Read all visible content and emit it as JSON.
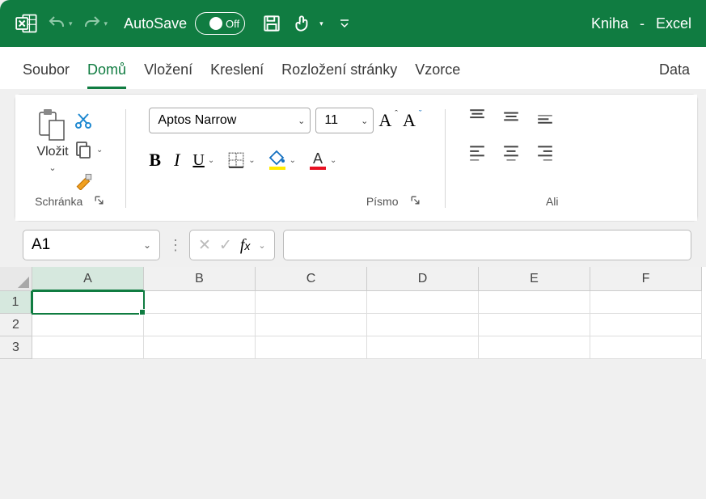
{
  "title": {
    "autosave_label": "AutoSave",
    "autosave_state": "Off",
    "doc_name": "Kniha",
    "separator": "-",
    "app_name": "Excel"
  },
  "tabs": [
    "Soubor",
    "Domů",
    "Vložení",
    "Kreslení",
    "Rozložení stránky",
    "Vzorce",
    "Data"
  ],
  "active_tab": 1,
  "clipboard": {
    "paste_label": "Vložit",
    "group_label": "Schránka"
  },
  "font": {
    "name": "Aptos Narrow",
    "size": "11",
    "group_label": "Písmo"
  },
  "align": {
    "group_label": "Ali"
  },
  "namebox": "A1",
  "columns": [
    "A",
    "B",
    "C",
    "D",
    "E",
    "F"
  ],
  "rows": [
    "1",
    "2",
    "3"
  ],
  "selected": {
    "col": 0,
    "row": 0
  }
}
